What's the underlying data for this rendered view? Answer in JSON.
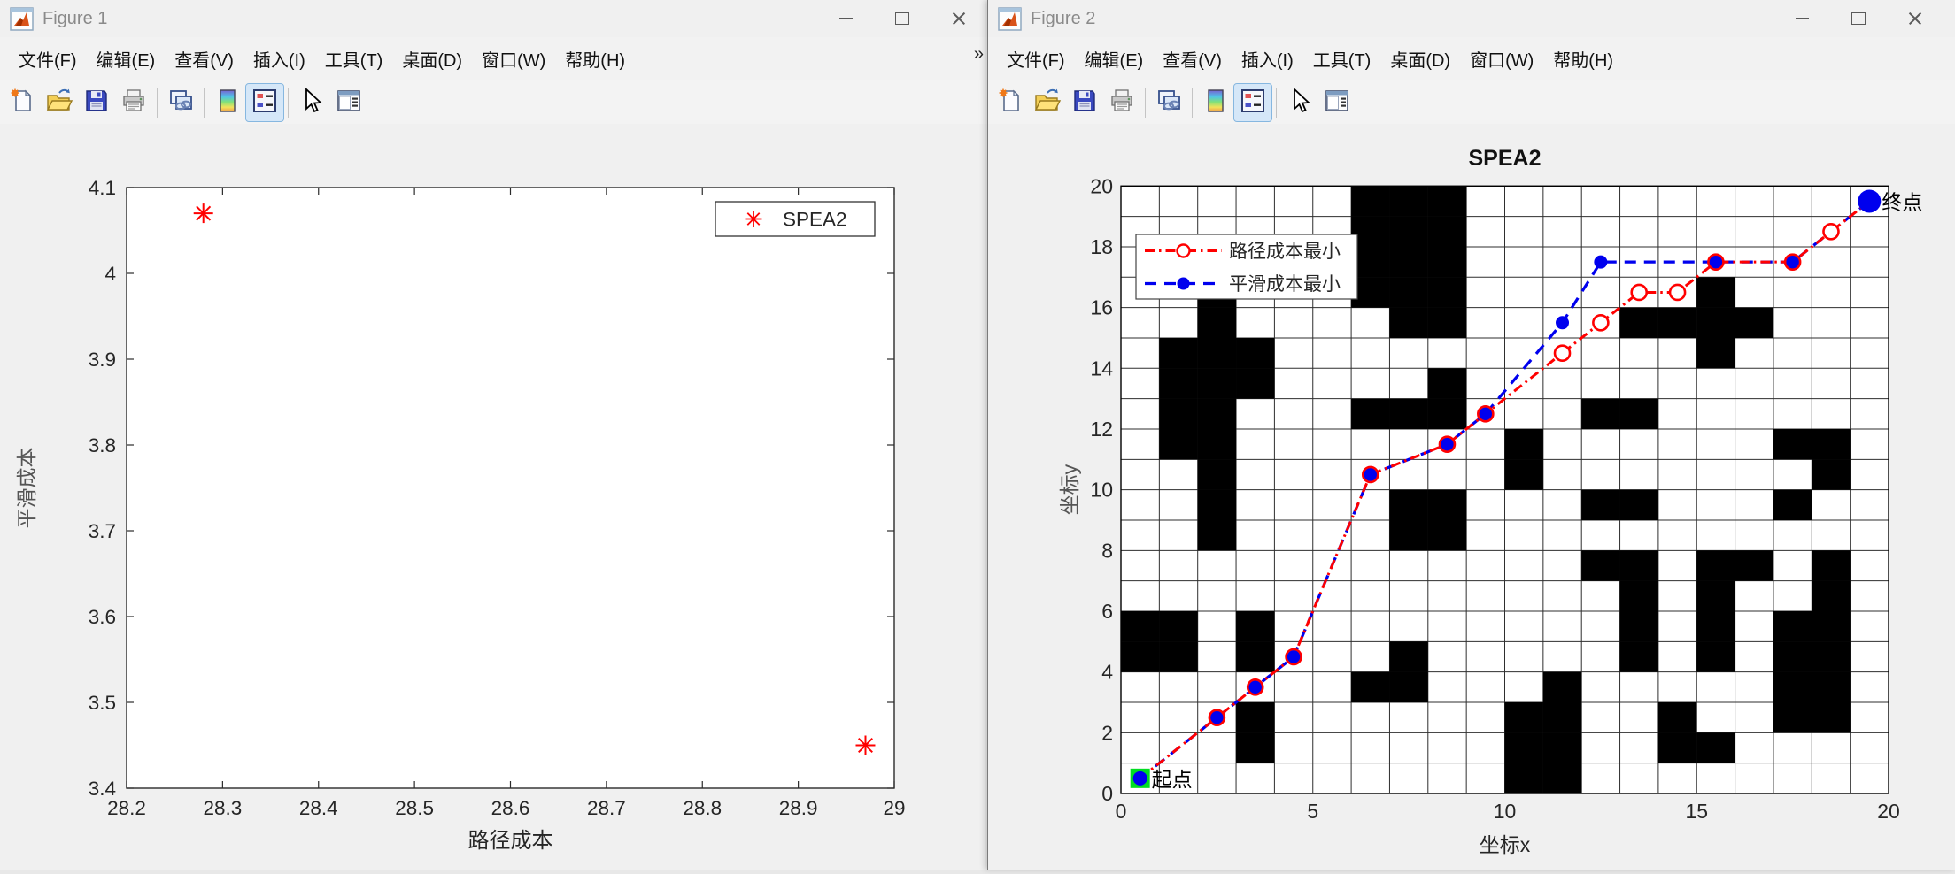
{
  "windows": [
    {
      "title": "Figure 1",
      "menu": [
        "文件(F)",
        "编辑(E)",
        "查看(V)",
        "插入(I)",
        "工具(T)",
        "桌面(D)",
        "窗口(W)",
        "帮助(H)"
      ],
      "menu_overflow": "»",
      "toolbar_icons": [
        "new-figure",
        "open-file",
        "save-figure",
        "print-figure",
        "copy-figure",
        "colormap-editor",
        "property-editor",
        "pointer",
        "plot-browser"
      ],
      "titlebar_icons": [
        "matlab-figure-icon",
        "minimize",
        "maximize",
        "close"
      ]
    },
    {
      "title": "Figure 2",
      "menu": [
        "文件(F)",
        "编辑(E)",
        "查看(V)",
        "插入(I)",
        "工具(T)",
        "桌面(D)",
        "窗口(W)",
        "帮助(H)"
      ],
      "menu_overflow": "",
      "toolbar_icons": [
        "new-figure",
        "open-file",
        "save-figure",
        "print-figure",
        "copy-figure",
        "colormap-editor",
        "property-editor",
        "pointer",
        "plot-browser"
      ],
      "titlebar_icons": [
        "matlab-figure-icon",
        "minimize",
        "maximize",
        "close"
      ]
    }
  ],
  "chart_data": [
    {
      "type": "scatter",
      "title": "",
      "xlabel": "路径成本",
      "ylabel": "平滑成本",
      "xlim": [
        28.2,
        29
      ],
      "ylim": [
        3.4,
        4.1
      ],
      "xticks": [
        "28.2",
        "28.3",
        "28.4",
        "28.5",
        "28.6",
        "28.7",
        "28.8",
        "28.9",
        "29"
      ],
      "yticks": [
        "3.4",
        "3.5",
        "3.6",
        "3.7",
        "3.8",
        "3.9",
        "4",
        "4.1"
      ],
      "grid": false,
      "marker": "asterisk",
      "marker_color": "#ff0000",
      "legend": {
        "label": "SPEA2",
        "position": "top-right"
      },
      "points": [
        [
          28.28,
          4.07
        ],
        [
          28.97,
          3.45
        ]
      ]
    },
    {
      "type": "grid-map",
      "title": "SPEA2",
      "xlabel": "坐标x",
      "ylabel": "坐标y",
      "xlim": [
        0,
        20
      ],
      "ylim": [
        0,
        20
      ],
      "xticks": [
        "0",
        "5",
        "10",
        "15",
        "20"
      ],
      "yticks": [
        "0",
        "2",
        "4",
        "6",
        "8",
        "10",
        "12",
        "14",
        "16",
        "18",
        "20"
      ],
      "grid_size": [
        20,
        20
      ],
      "obstacle_color": "#000000",
      "obstacles": [
        [
          6,
          19
        ],
        [
          7,
          19
        ],
        [
          8,
          19
        ],
        [
          6,
          18
        ],
        [
          7,
          18
        ],
        [
          8,
          18
        ],
        [
          6,
          17
        ],
        [
          7,
          17
        ],
        [
          8,
          17
        ],
        [
          2,
          16
        ],
        [
          6,
          16
        ],
        [
          7,
          16
        ],
        [
          8,
          16
        ],
        [
          15,
          16
        ],
        [
          2,
          15
        ],
        [
          7,
          15
        ],
        [
          8,
          15
        ],
        [
          13,
          15
        ],
        [
          14,
          15
        ],
        [
          15,
          15
        ],
        [
          16,
          15
        ],
        [
          1,
          14
        ],
        [
          2,
          14
        ],
        [
          3,
          14
        ],
        [
          15,
          14
        ],
        [
          1,
          13
        ],
        [
          2,
          13
        ],
        [
          3,
          13
        ],
        [
          8,
          13
        ],
        [
          1,
          12
        ],
        [
          2,
          12
        ],
        [
          6,
          12
        ],
        [
          7,
          12
        ],
        [
          8,
          12
        ],
        [
          12,
          12
        ],
        [
          13,
          12
        ],
        [
          1,
          11
        ],
        [
          2,
          11
        ],
        [
          10,
          11
        ],
        [
          17,
          11
        ],
        [
          18,
          11
        ],
        [
          2,
          10
        ],
        [
          10,
          10
        ],
        [
          18,
          10
        ],
        [
          2,
          9
        ],
        [
          7,
          9
        ],
        [
          8,
          9
        ],
        [
          12,
          9
        ],
        [
          13,
          9
        ],
        [
          17,
          9
        ],
        [
          2,
          8
        ],
        [
          7,
          8
        ],
        [
          8,
          8
        ],
        [
          12,
          7
        ],
        [
          13,
          7
        ],
        [
          15,
          7
        ],
        [
          16,
          7
        ],
        [
          18,
          7
        ],
        [
          13,
          6
        ],
        [
          15,
          6
        ],
        [
          18,
          6
        ],
        [
          0,
          5
        ],
        [
          1,
          5
        ],
        [
          3,
          5
        ],
        [
          13,
          5
        ],
        [
          15,
          5
        ],
        [
          17,
          5
        ],
        [
          18,
          5
        ],
        [
          0,
          4
        ],
        [
          1,
          4
        ],
        [
          3,
          4
        ],
        [
          7,
          4
        ],
        [
          13,
          4
        ],
        [
          15,
          4
        ],
        [
          17,
          4
        ],
        [
          18,
          4
        ],
        [
          6,
          3
        ],
        [
          7,
          3
        ],
        [
          11,
          3
        ],
        [
          17,
          3
        ],
        [
          18,
          3
        ],
        [
          3,
          2
        ],
        [
          10,
          2
        ],
        [
          11,
          2
        ],
        [
          14,
          2
        ],
        [
          17,
          2
        ],
        [
          18,
          2
        ],
        [
          3,
          1
        ],
        [
          10,
          1
        ],
        [
          11,
          1
        ],
        [
          14,
          1
        ],
        [
          15,
          1
        ],
        [
          10,
          0
        ],
        [
          11,
          0
        ]
      ],
      "series": [
        {
          "name": "路径成本最小",
          "color": "#ff0000",
          "line": "dash-dot",
          "marker": "open-circle",
          "points": [
            [
              0.5,
              0.5
            ],
            [
              2.5,
              2.5
            ],
            [
              3.5,
              3.5
            ],
            [
              4.5,
              4.5
            ],
            [
              6.5,
              10.5
            ],
            [
              8.5,
              11.5
            ],
            [
              9.5,
              12.5
            ],
            [
              11.5,
              14.5
            ],
            [
              12.5,
              15.5
            ],
            [
              13.5,
              16.5
            ],
            [
              14.5,
              16.5
            ],
            [
              15.5,
              17.5
            ],
            [
              17.5,
              17.5
            ],
            [
              18.5,
              18.5
            ],
            [
              19.5,
              19.5
            ]
          ]
        },
        {
          "name": "平滑成本最小",
          "color": "#0000ee",
          "line": "dashed",
          "marker": "filled-circle",
          "points": [
            [
              0.5,
              0.5
            ],
            [
              2.5,
              2.5
            ],
            [
              3.5,
              3.5
            ],
            [
              4.5,
              4.5
            ],
            [
              6.5,
              10.5
            ],
            [
              8.5,
              11.5
            ],
            [
              9.5,
              12.5
            ],
            [
              11.5,
              15.5
            ],
            [
              12.5,
              17.5
            ],
            [
              15.5,
              17.5
            ],
            [
              17.5,
              17.5
            ],
            [
              19.5,
              19.5
            ]
          ]
        }
      ],
      "start": {
        "label": "起点",
        "pos": [
          0.5,
          0.5
        ],
        "color": "#00dd22"
      },
      "end": {
        "label": "终点",
        "pos": [
          19.5,
          19.5
        ],
        "color": "#0000ee"
      },
      "legend_position": "top-left"
    }
  ]
}
